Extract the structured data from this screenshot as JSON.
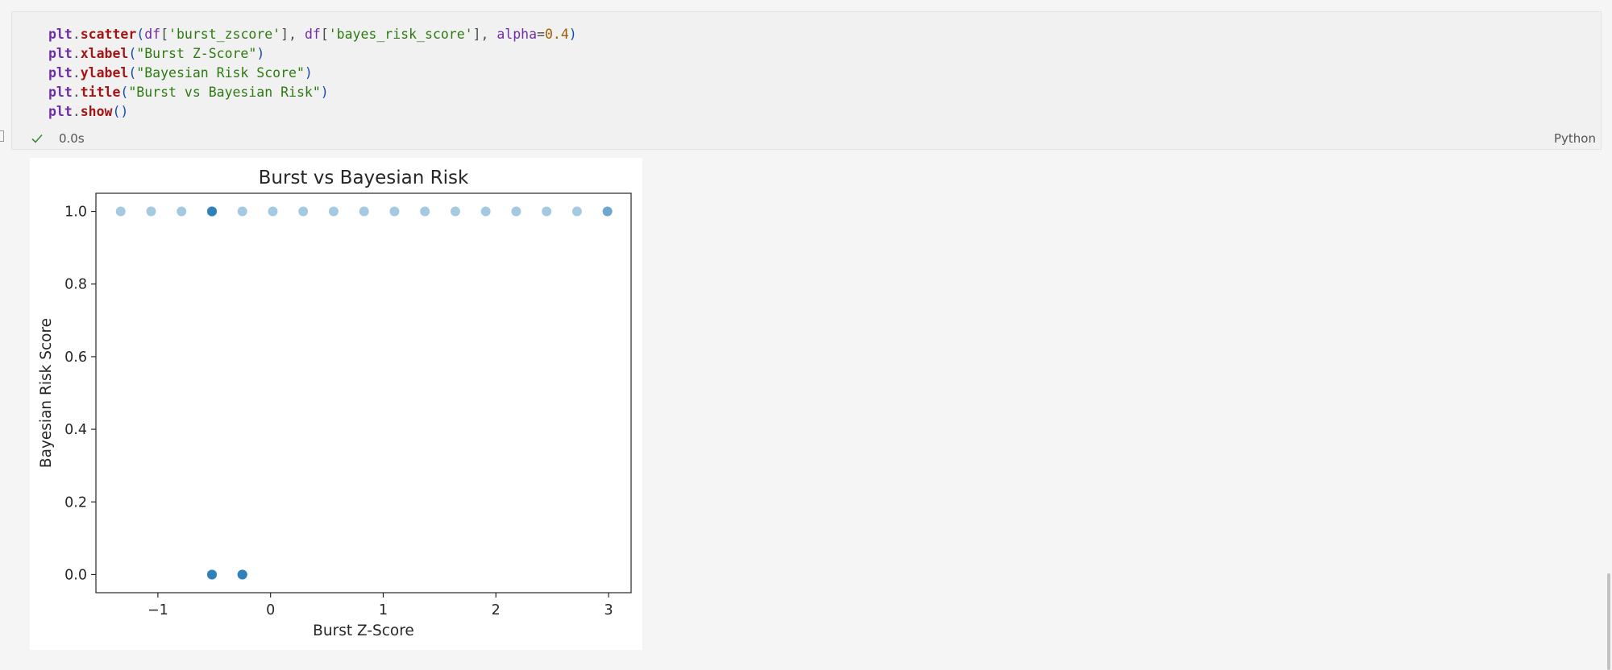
{
  "code": {
    "lines": [
      [
        {
          "t": "plt",
          "c": "obj"
        },
        {
          "t": ".",
          "c": "txt"
        },
        {
          "t": "scatter",
          "c": "fn"
        },
        {
          "t": "(",
          "c": "par"
        },
        {
          "t": "df",
          "c": "kw"
        },
        {
          "t": "[",
          "c": "txt"
        },
        {
          "t": "'burst_zscore'",
          "c": "str"
        },
        {
          "t": "], ",
          "c": "txt"
        },
        {
          "t": "df",
          "c": "kw"
        },
        {
          "t": "[",
          "c": "txt"
        },
        {
          "t": "'bayes_risk_score'",
          "c": "str"
        },
        {
          "t": "], ",
          "c": "txt"
        },
        {
          "t": "alpha",
          "c": "kw"
        },
        {
          "t": "=",
          "c": "txt"
        },
        {
          "t": "0.4",
          "c": "num"
        },
        {
          "t": ")",
          "c": "par"
        }
      ],
      [
        {
          "t": "plt",
          "c": "obj"
        },
        {
          "t": ".",
          "c": "txt"
        },
        {
          "t": "xlabel",
          "c": "fn"
        },
        {
          "t": "(",
          "c": "par"
        },
        {
          "t": "\"Burst Z-Score\"",
          "c": "str"
        },
        {
          "t": ")",
          "c": "par"
        }
      ],
      [
        {
          "t": "plt",
          "c": "obj"
        },
        {
          "t": ".",
          "c": "txt"
        },
        {
          "t": "ylabel",
          "c": "fn"
        },
        {
          "t": "(",
          "c": "par"
        },
        {
          "t": "\"Bayesian Risk Score\"",
          "c": "str"
        },
        {
          "t": ")",
          "c": "par"
        }
      ],
      [
        {
          "t": "plt",
          "c": "obj"
        },
        {
          "t": ".",
          "c": "txt"
        },
        {
          "t": "title",
          "c": "fn"
        },
        {
          "t": "(",
          "c": "par"
        },
        {
          "t": "\"Burst vs Bayesian Risk\"",
          "c": "str"
        },
        {
          "t": ")",
          "c": "par"
        }
      ],
      [
        {
          "t": "plt",
          "c": "obj"
        },
        {
          "t": ".",
          "c": "txt"
        },
        {
          "t": "show",
          "c": "fn"
        },
        {
          "t": "()",
          "c": "par"
        }
      ]
    ]
  },
  "cell": {
    "status_icon": "check-icon",
    "exec_time": "0.0s",
    "language": "Python"
  },
  "colors": {
    "marker": "#1f77b4",
    "string": "#2d7a12",
    "function": "#a31515",
    "object": "#6f2da8"
  },
  "chart_data": {
    "type": "scatter",
    "title": "Burst vs Bayesian Risk",
    "xlabel": "Burst Z-Score",
    "ylabel": "Bayesian Risk Score",
    "xlim": [
      -1.55,
      3.2
    ],
    "ylim": [
      -0.05,
      1.05
    ],
    "xticks": [
      -1,
      0,
      1,
      2,
      3
    ],
    "xtick_labels": [
      "−1",
      "0",
      "1",
      "2",
      "3"
    ],
    "yticks": [
      0.0,
      0.2,
      0.4,
      0.6,
      0.8,
      1.0
    ],
    "ytick_labels": [
      "0.0",
      "0.2",
      "0.4",
      "0.6",
      "0.8",
      "1.0"
    ],
    "alpha": 0.4,
    "grid": false,
    "points": [
      {
        "x": -1.33,
        "y": 1.0
      },
      {
        "x": -1.06,
        "y": 1.0
      },
      {
        "x": -0.79,
        "y": 1.0
      },
      {
        "x": -0.52,
        "y": 1.0
      },
      {
        "x": -0.52,
        "y": 1.0
      },
      {
        "x": -0.52,
        "y": 1.0
      },
      {
        "x": -0.52,
        "y": 1.0
      },
      {
        "x": -0.52,
        "y": 1.0
      },
      {
        "x": -0.25,
        "y": 1.0
      },
      {
        "x": 0.02,
        "y": 1.0
      },
      {
        "x": 0.29,
        "y": 1.0
      },
      {
        "x": 0.56,
        "y": 1.0
      },
      {
        "x": 0.83,
        "y": 1.0
      },
      {
        "x": 1.1,
        "y": 1.0
      },
      {
        "x": 1.37,
        "y": 1.0
      },
      {
        "x": 1.64,
        "y": 1.0
      },
      {
        "x": 1.91,
        "y": 1.0
      },
      {
        "x": 2.18,
        "y": 1.0
      },
      {
        "x": 2.45,
        "y": 1.0
      },
      {
        "x": 2.72,
        "y": 1.0
      },
      {
        "x": 2.99,
        "y": 1.0
      },
      {
        "x": 2.99,
        "y": 1.0
      },
      {
        "x": -0.52,
        "y": 0.0
      },
      {
        "x": -0.52,
        "y": 0.0
      },
      {
        "x": -0.52,
        "y": 0.0
      },
      {
        "x": -0.52,
        "y": 0.0
      },
      {
        "x": -0.52,
        "y": 0.0
      },
      {
        "x": -0.25,
        "y": 0.0
      },
      {
        "x": -0.25,
        "y": 0.0
      },
      {
        "x": -0.25,
        "y": 0.0
      },
      {
        "x": -0.25,
        "y": 0.0
      },
      {
        "x": -0.25,
        "y": 0.0
      }
    ]
  }
}
